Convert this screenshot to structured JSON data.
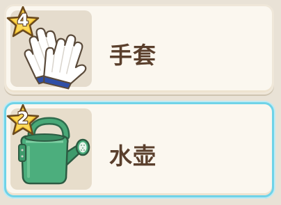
{
  "items": [
    {
      "name": "手套",
      "level": "4",
      "icon": "gloves-icon",
      "selected": false
    },
    {
      "name": "水壶",
      "level": "2",
      "icon": "watering-can-icon",
      "selected": true
    }
  ],
  "colors": {
    "background": "#e9e2d6",
    "card": "#fbf7ef",
    "icon_panel": "#e5dccd",
    "selected_border": "#6fd3e8",
    "text": "#5a3f2c",
    "star": "#f7c531"
  }
}
